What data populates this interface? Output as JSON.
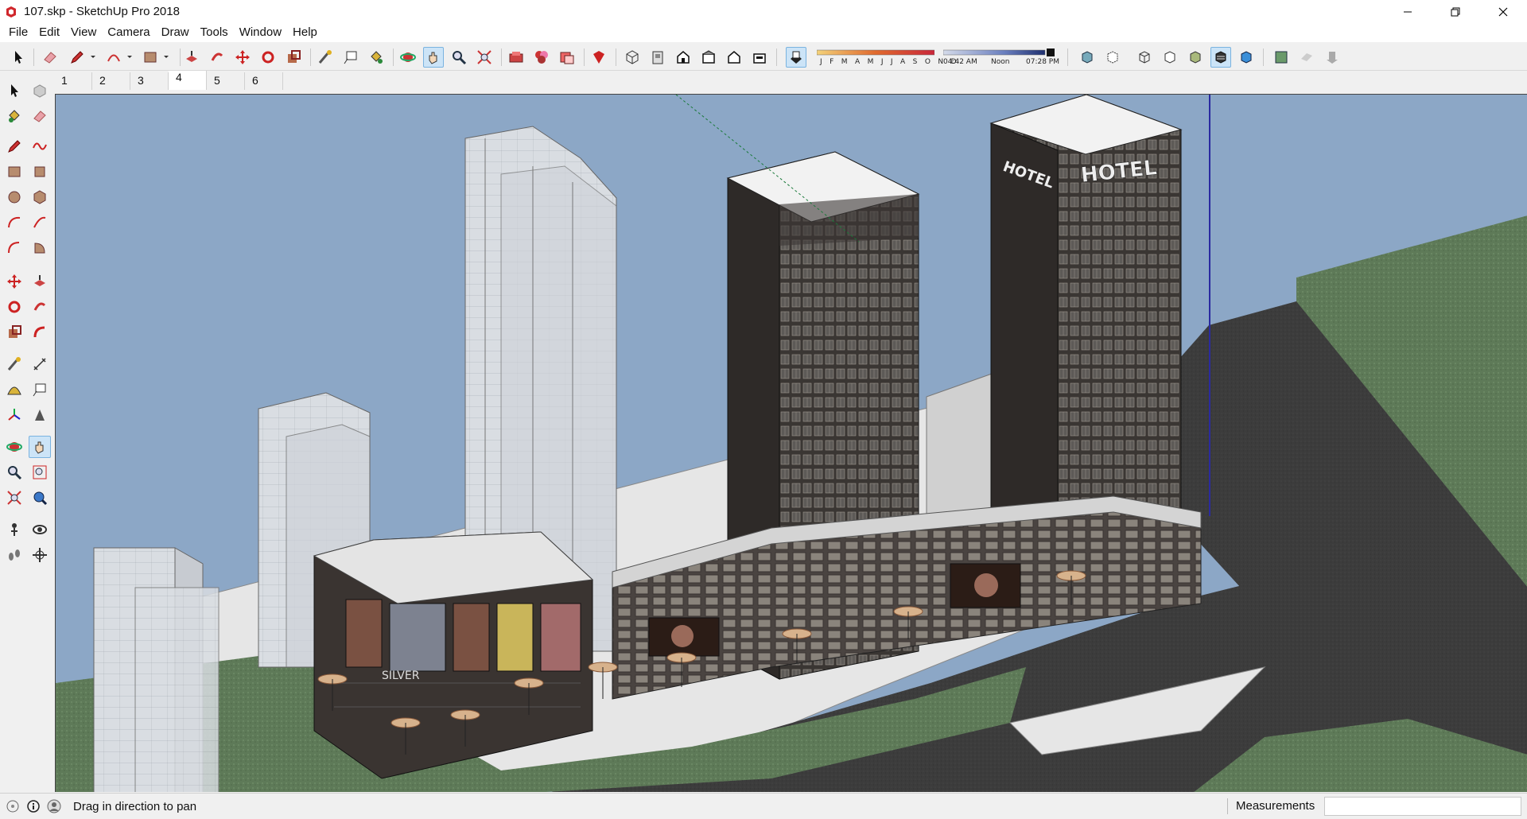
{
  "window": {
    "title": "107.skp - SketchUp Pro 2018",
    "controls": [
      "minimize-icon",
      "restore-icon",
      "close-icon"
    ]
  },
  "menu": [
    "File",
    "Edit",
    "View",
    "Camera",
    "Draw",
    "Tools",
    "Window",
    "Help"
  ],
  "toolbar": {
    "tools": [
      "select-icon",
      "eraser-icon",
      "pencil-icon",
      "freehand-icon",
      "rectangle-icon",
      "push-pull-icon",
      "follow-me-icon",
      "move-icon",
      "rotate-icon",
      "scale-icon",
      "tape-measure-icon",
      "text-icon",
      "paint-bucket-icon",
      "orbit-icon",
      "pan-icon",
      "zoom-icon",
      "zoom-extents-icon",
      "components-icon",
      "materials-icon",
      "styles-icon",
      "warehouse-icon",
      "iso-view-icon",
      "top-view-icon",
      "front-view-icon",
      "right-view-icon",
      "back-view-icon",
      "left-view-icon",
      "shadows-icon",
      "xray-icon",
      "back-edges-icon",
      "wireframe-icon",
      "hidden-line-icon",
      "shaded-icon",
      "shaded-textures-icon",
      "monochrome-icon",
      "section-plane-icon",
      "section-display-icon",
      "section-cuts-icon"
    ],
    "months": "J F M A M J J A S O N D",
    "time_start": "04:42 AM",
    "time_mid": "Noon",
    "time_end": "07:28 PM"
  },
  "scenes": [
    "1",
    "2",
    "3",
    "4",
    "5",
    "6"
  ],
  "active_scene": "4",
  "viewport": {
    "signage": [
      "HOTEL",
      "HOTEL",
      "SILVER"
    ],
    "colors": {
      "sky": "#8ca7c6",
      "grass": "#5e7a58",
      "road": "#3c3c3c",
      "tower": "#3a3633",
      "glass": "#e3e6ea"
    }
  },
  "status": {
    "message": "Drag in direction to pan",
    "measurements_label": "Measurements",
    "measurements_value": ""
  }
}
